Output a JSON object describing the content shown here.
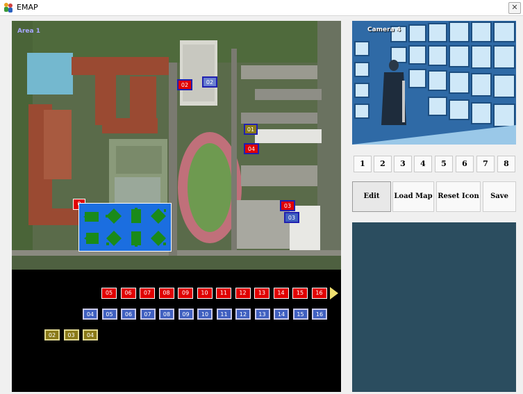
{
  "window": {
    "title": "EMAP",
    "close_glyph": "✕",
    "app_icon": "people-icon"
  },
  "map": {
    "area_label": "Area 1",
    "placed_cameras": [
      {
        "label": "02",
        "style": "red"
      },
      {
        "label": "02",
        "style": "blue"
      },
      {
        "label": "01",
        "style": "yellow"
      },
      {
        "label": "04",
        "style": "red"
      },
      {
        "label": "03",
        "style": "red"
      },
      {
        "label": "03",
        "style": "blue"
      },
      {
        "label": "0",
        "style": "red"
      }
    ],
    "tray_red": [
      "05",
      "06",
      "07",
      "08",
      "09",
      "10",
      "11",
      "12",
      "13",
      "14",
      "15",
      "16"
    ],
    "tray_blue": [
      "04",
      "05",
      "06",
      "07",
      "08",
      "09",
      "10",
      "11",
      "12",
      "13",
      "14",
      "15",
      "16"
    ],
    "tray_yellow": [
      "02",
      "03",
      "04"
    ],
    "ptz_icons": [
      "rect-left",
      "diamond-left",
      "rect-vertical",
      "diamond-right",
      "rect-left-flipped",
      "diamond-left-flipped",
      "rect-vertical-flipped",
      "diamond-right-flipped"
    ],
    "colors": {
      "red": "#e00000",
      "blue": "#4060c0",
      "yellow": "#8a7a18",
      "ptz_bg": "#1b6ee0",
      "ptz_icon": "#1a8a1a"
    }
  },
  "camera_view": {
    "label": "Camera 4"
  },
  "channel_buttons": [
    "1",
    "2",
    "3",
    "4",
    "5",
    "6",
    "7",
    "8"
  ],
  "actions": {
    "edit": "Edit",
    "load_map": "Load Map",
    "reset_icon": "Reset Icon",
    "save": "Save"
  },
  "info_panel": {
    "color": "#2b4d5f"
  }
}
